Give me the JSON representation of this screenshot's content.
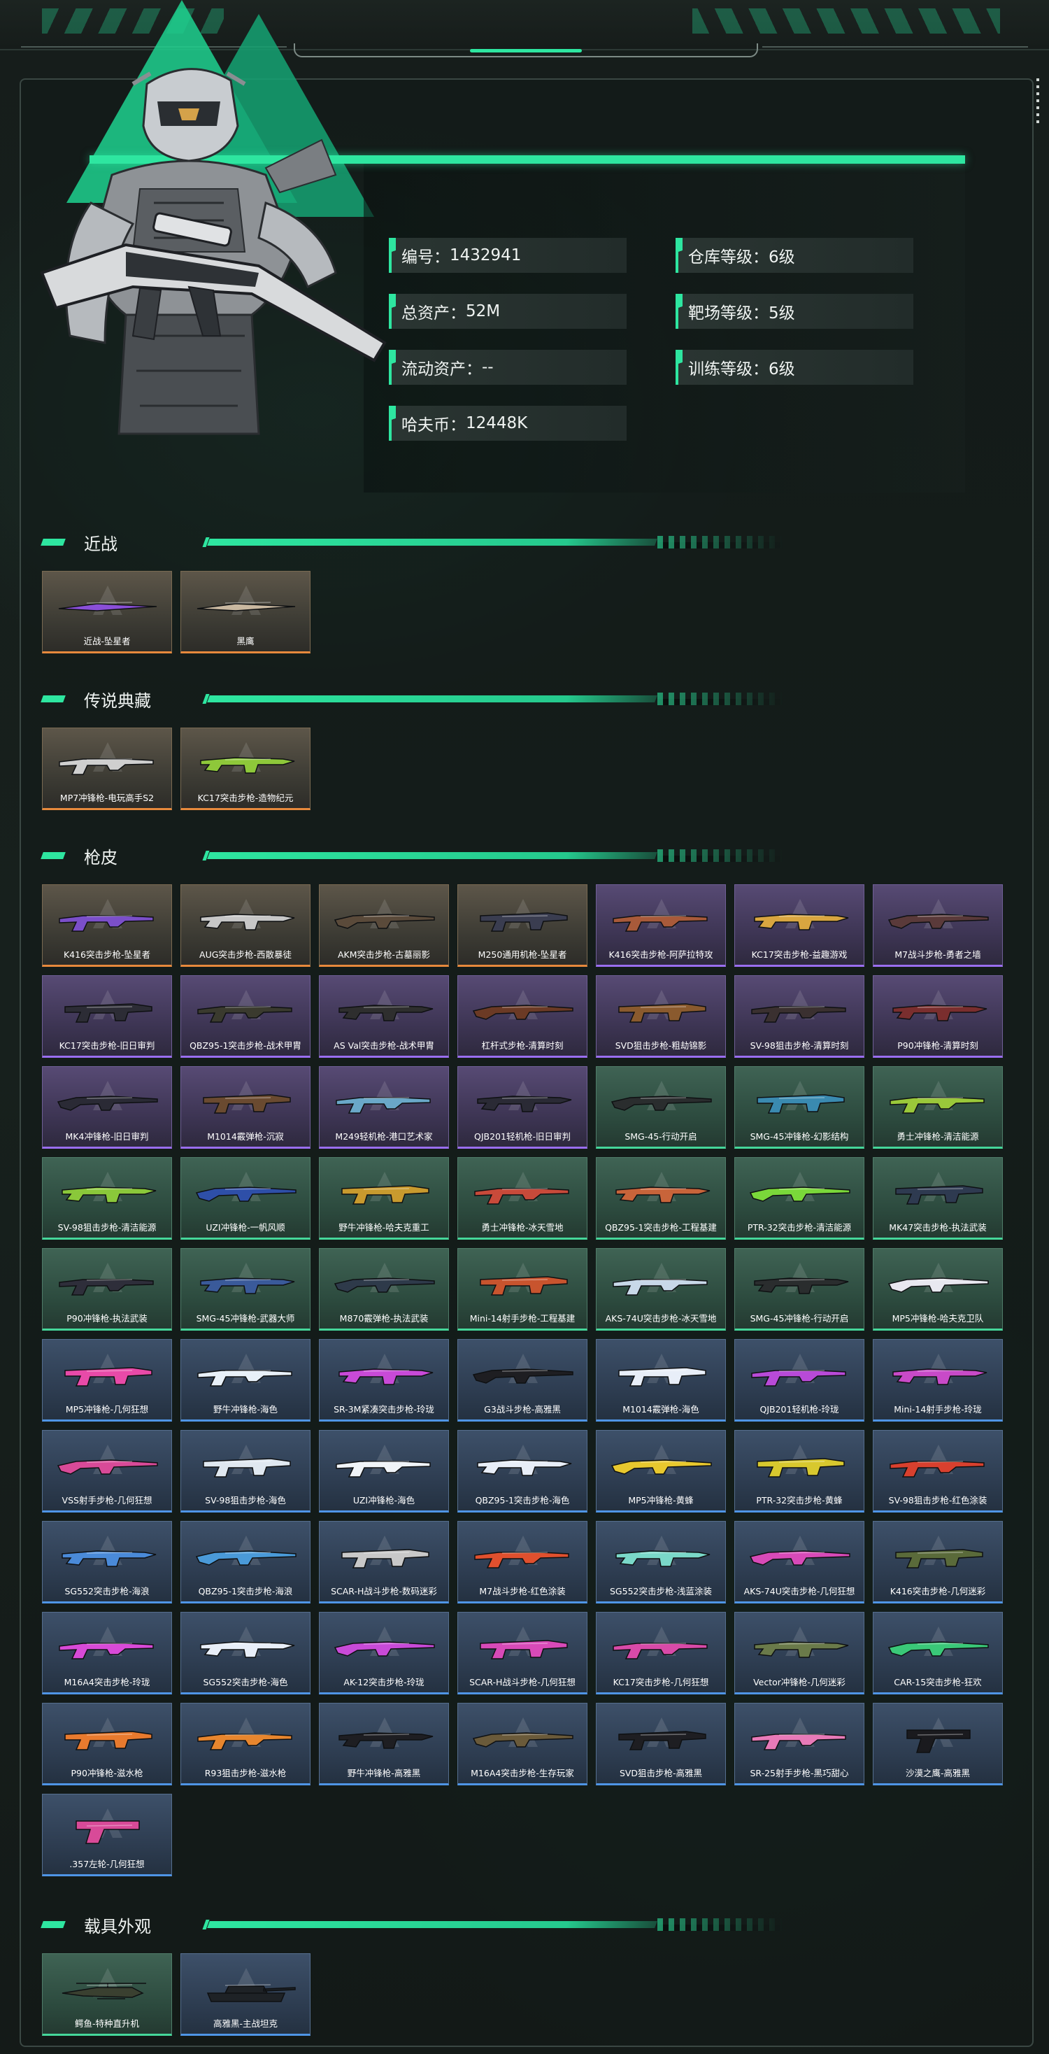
{
  "profile": {
    "stats_left": [
      {
        "label": "编号",
        "value": "1432941"
      },
      {
        "label": "总资产",
        "value": "52M"
      },
      {
        "label": "流动资产",
        "value": "--"
      },
      {
        "label": "哈夫币",
        "value": "12448K"
      }
    ],
    "stats_right": [
      {
        "label": "仓库等级",
        "value": "6级"
      },
      {
        "label": "靶场等级",
        "value": "5级"
      },
      {
        "label": "训练等级",
        "value": "6级"
      }
    ]
  },
  "sections": [
    {
      "title": "近战",
      "items": [
        {
          "name": "近战-坠星者",
          "rarity": "gold",
          "color": "#8a4fd8"
        },
        {
          "name": "黑鹰",
          "rarity": "gold",
          "color": "#c9b8a0"
        }
      ]
    },
    {
      "title": "传说典藏",
      "items": [
        {
          "name": "MP7冲锋枪-电玩高手S2",
          "rarity": "gold",
          "color": "#cfcfcf"
        },
        {
          "name": "KC17突击步枪-造物纪元",
          "rarity": "gold",
          "color": "#8ec83a"
        }
      ]
    },
    {
      "title": "枪皮",
      "items": [
        {
          "name": "K416突击步枪-坠星者",
          "rarity": "gold",
          "color": "#7b4fc9"
        },
        {
          "name": "AUG突击步枪-西散暴徒",
          "rarity": "gold",
          "color": "#c7c7c7"
        },
        {
          "name": "AKM突击步枪-古墓丽影",
          "rarity": "gold",
          "color": "#5a4a3a"
        },
        {
          "name": "M250通用机枪-坠星者",
          "rarity": "gold",
          "color": "#3a3d50"
        },
        {
          "name": "K416突击步枪-阿萨拉特攻",
          "rarity": "purple",
          "color": "#a85a3a"
        },
        {
          "name": "KC17突击步枪-益趣游戏",
          "rarity": "purple",
          "color": "#d9a640"
        },
        {
          "name": "M7战斗步枪-勇者之墙",
          "rarity": "purple",
          "color": "#5a3a3a"
        },
        {
          "name": "KC17突击步枪-旧日审判",
          "rarity": "purple",
          "color": "#2c2c35"
        },
        {
          "name": "QBZ95-1突击步枪-战术甲胄",
          "rarity": "purple",
          "color": "#3a3a2e"
        },
        {
          "name": "AS Val突击步枪-战术甲胄",
          "rarity": "purple",
          "color": "#2e2e2e"
        },
        {
          "name": "杠杆式步枪-清算时刻",
          "rarity": "purple",
          "color": "#6b3a25"
        },
        {
          "name": "SVD狙击步枪-粗劫锦影",
          "rarity": "purple",
          "color": "#8a5a2e"
        },
        {
          "name": "SV-98狙击步枪-清算时刻",
          "rarity": "purple",
          "color": "#3a3030"
        },
        {
          "name": "P90冲锋枪-清算时刻",
          "rarity": "purple",
          "color": "#7a2e2e"
        },
        {
          "name": "MK4冲锋枪-旧日审判",
          "rarity": "purple",
          "color": "#2a2a35"
        },
        {
          "name": "M1014霰弹枪-沉寂",
          "rarity": "purple",
          "color": "#6a4a30"
        },
        {
          "name": "M249轻机枪-港口艺术家",
          "rarity": "purple",
          "color": "#6aa8c8"
        },
        {
          "name": "QJB201轻机枪-旧日审判",
          "rarity": "purple",
          "color": "#2a2a35"
        },
        {
          "name": "SMG-45-行动开启",
          "rarity": "green",
          "color": "#2a2d2e"
        },
        {
          "name": "SMG-45冲锋枪-幻影结构",
          "rarity": "green",
          "color": "#3a8ab0"
        },
        {
          "name": "勇士冲锋枪-清洁能源",
          "rarity": "green",
          "color": "#9ac83a"
        },
        {
          "name": "SV-98狙击步枪-清洁能源",
          "rarity": "green",
          "color": "#8ac83a"
        },
        {
          "name": "UZI冲锋枪-一帆风顺",
          "rarity": "green",
          "color": "#2e4fa8"
        },
        {
          "name": "野牛冲锋枪-哈夫克重工",
          "rarity": "green",
          "color": "#c89a2e"
        },
        {
          "name": "勇士冲锋枪-冰天雪地",
          "rarity": "green",
          "color": "#c84a3a"
        },
        {
          "name": "QBZ95-1突击步枪-工程基建",
          "rarity": "green",
          "color": "#c8643a"
        },
        {
          "name": "PTR-32突击步枪-清洁能源",
          "rarity": "green",
          "color": "#7ad83a"
        },
        {
          "name": "MK47突击步枪-执法武装",
          "rarity": "green",
          "color": "#2e3a50"
        },
        {
          "name": "P90冲锋枪-执法武装",
          "rarity": "green",
          "color": "#2e2e3a"
        },
        {
          "name": "SMG-45冲锋枪-武器大师",
          "rarity": "green",
          "color": "#3a5a9a"
        },
        {
          "name": "M870霰弹枪-执法武装",
          "rarity": "green",
          "color": "#2e3a4a"
        },
        {
          "name": "Mini-14射手步枪-工程基建",
          "rarity": "green",
          "color": "#c8542e"
        },
        {
          "name": "AKS-74U突击步枪-冰天雪地",
          "rarity": "green",
          "color": "#c8d8e8"
        },
        {
          "name": "SMG-45冲锋枪-行动开启",
          "rarity": "green",
          "color": "#2a2d2e"
        },
        {
          "name": "MP5冲锋枪-哈夫克卫队",
          "rarity": "green",
          "color": "#e8e8f0"
        },
        {
          "name": "MP5冲锋枪-几何狂想",
          "rarity": "blue",
          "color": "#e84aa8"
        },
        {
          "name": "野牛冲锋枪-海色",
          "rarity": "blue",
          "color": "#e8f0f8"
        },
        {
          "name": "SR-3M紧凑突击步枪-玲珑",
          "rarity": "blue",
          "color": "#c84ad8"
        },
        {
          "name": "G3战斗步枪-高雅黑",
          "rarity": "blue",
          "color": "#1e1e22"
        },
        {
          "name": "M1014霰弹枪-海色",
          "rarity": "blue",
          "color": "#e8eef8"
        },
        {
          "name": "QJB201轻机枪-玲珑",
          "rarity": "blue",
          "color": "#b84ad8"
        },
        {
          "name": "Mini-14射手步枪-玲珑",
          "rarity": "blue",
          "color": "#c84ac8"
        },
        {
          "name": "VSS射手步枪-几何狂想",
          "rarity": "blue",
          "color": "#d84a98"
        },
        {
          "name": "SV-98狙击步枪-海色",
          "rarity": "blue",
          "color": "#e0e8f0"
        },
        {
          "name": "UZI冲锋枪-海色",
          "rarity": "blue",
          "color": "#f0f4f8"
        },
        {
          "name": "QBZ95-1突击步枪-海色",
          "rarity": "blue",
          "color": "#e8eef8"
        },
        {
          "name": "MP5冲锋枪-黄蜂",
          "rarity": "blue",
          "color": "#e8c82e"
        },
        {
          "name": "PTR-32突击步枪-黄蜂",
          "rarity": "blue",
          "color": "#d8c82e"
        },
        {
          "name": "SV-98狙击步枪-红色涂装",
          "rarity": "blue",
          "color": "#d8402e"
        },
        {
          "name": "SG552突击步枪-海浪",
          "rarity": "blue",
          "color": "#4a8ad8"
        },
        {
          "name": "QBZ95-1突击步枪-海浪",
          "rarity": "blue",
          "color": "#4a9ad8"
        },
        {
          "name": "SCAR-H战斗步枪-数码迷彩",
          "rarity": "blue",
          "color": "#c8c8c8"
        },
        {
          "name": "M7战斗步枪-红色涂装",
          "rarity": "blue",
          "color": "#e0502e"
        },
        {
          "name": "SG552突击步枪-浅蓝涂装",
          "rarity": "blue",
          "color": "#7ad8c8"
        },
        {
          "name": "AKS-74U突击步枪-几何狂想",
          "rarity": "blue",
          "color": "#d84ab8"
        },
        {
          "name": "K416突击步枪-几何迷彩",
          "rarity": "blue",
          "color": "#5a6a3a"
        },
        {
          "name": "M16A4突击步枪-玲珑",
          "rarity": "blue",
          "color": "#d84ad8"
        },
        {
          "name": "SG552突击步枪-海色",
          "rarity": "blue",
          "color": "#e8eef8"
        },
        {
          "name": "AK-12突击步枪-玲珑",
          "rarity": "blue",
          "color": "#c84ad8"
        },
        {
          "name": "SCAR-H战斗步枪-几何狂想",
          "rarity": "blue",
          "color": "#d84ab8"
        },
        {
          "name": "KC17突击步枪-几何狂想",
          "rarity": "blue",
          "color": "#d84aa8"
        },
        {
          "name": "Vector冲锋枪-几何迷彩",
          "rarity": "blue",
          "color": "#6a7a4a"
        },
        {
          "name": "CAR-15突击步枪-狂欢",
          "rarity": "blue",
          "color": "#3ac878"
        },
        {
          "name": "P90冲锋枪-滋水枪",
          "rarity": "blue",
          "color": "#e87a2e"
        },
        {
          "name": "R93狙击步枪-滋水枪",
          "rarity": "blue",
          "color": "#e8862e"
        },
        {
          "name": "野牛冲锋枪-高雅黑",
          "rarity": "blue",
          "color": "#1e1e22"
        },
        {
          "name": "M16A4突击步枪-生存玩家",
          "rarity": "blue",
          "color": "#6a5a3a"
        },
        {
          "name": "SVD狙击步枪-高雅黑",
          "rarity": "blue",
          "color": "#1e1e22"
        },
        {
          "name": "SR-25射手步枪-黑巧甜心",
          "rarity": "blue",
          "color": "#e87ab8"
        },
        {
          "name": "沙漠之鹰-高雅黑",
          "rarity": "blue",
          "color": "#1a1a1e"
        },
        {
          "name": ".357左轮-几何狂想",
          "rarity": "blue",
          "color": "#d84a98"
        }
      ]
    },
    {
      "title": "载具外观",
      "items": [
        {
          "name": "鳄鱼-特种直升机",
          "rarity": "green",
          "color": "#3a4030"
        },
        {
          "name": "高雅黑-主战坦克",
          "rarity": "blue",
          "color": "#1e2226"
        }
      ]
    }
  ]
}
